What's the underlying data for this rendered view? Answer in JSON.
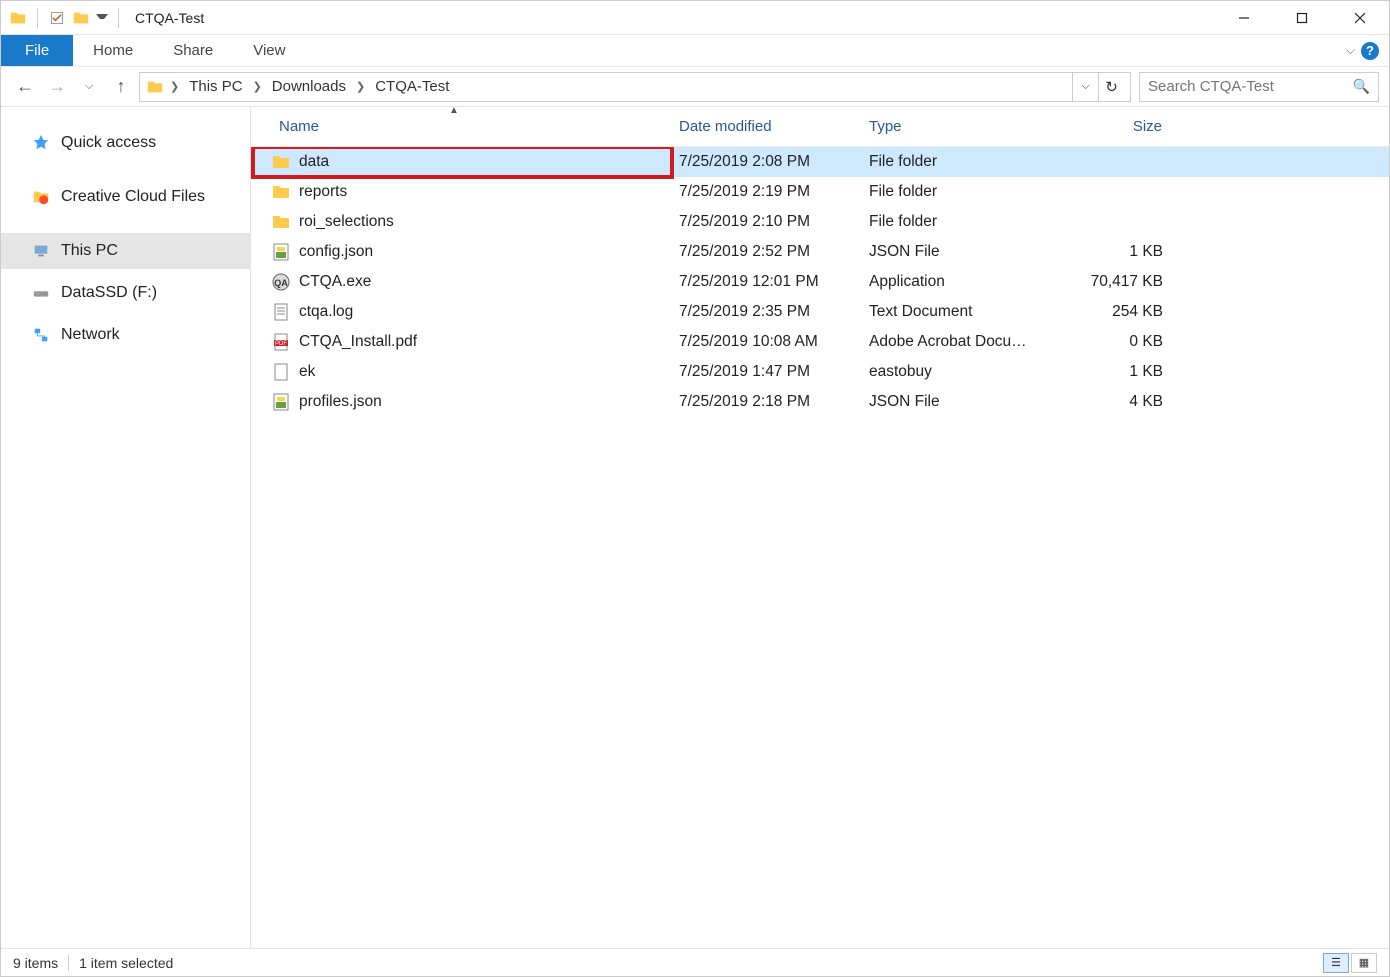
{
  "window": {
    "title": "CTQA-Test"
  },
  "ribbon": {
    "file": "File",
    "home": "Home",
    "share": "Share",
    "view": "View"
  },
  "breadcrumbs": [
    "This PC",
    "Downloads",
    "CTQA-Test"
  ],
  "search": {
    "placeholder": "Search CTQA-Test"
  },
  "sidebar": {
    "items": [
      {
        "label": "Quick access",
        "icon": "star"
      },
      {
        "label": "Creative Cloud Files",
        "icon": "cc"
      },
      {
        "label": "This PC",
        "icon": "pc",
        "selected": true
      },
      {
        "label": "DataSSD (F:)",
        "icon": "drive"
      },
      {
        "label": "Network",
        "icon": "net"
      }
    ]
  },
  "columns": {
    "name": "Name",
    "date": "Date modified",
    "type": "Type",
    "size": "Size"
  },
  "rows": [
    {
      "name": "data",
      "date": "7/25/2019 2:08 PM",
      "type": "File folder",
      "size": "",
      "icon": "folder",
      "selected": true,
      "highlight": true
    },
    {
      "name": "reports",
      "date": "7/25/2019 2:19 PM",
      "type": "File folder",
      "size": "",
      "icon": "folder"
    },
    {
      "name": "roi_selections",
      "date": "7/25/2019 2:10 PM",
      "type": "File folder",
      "size": "",
      "icon": "folder"
    },
    {
      "name": "config.json",
      "date": "7/25/2019 2:52 PM",
      "type": "JSON File",
      "size": "1 KB",
      "icon": "json"
    },
    {
      "name": "CTQA.exe",
      "date": "7/25/2019 12:01 PM",
      "type": "Application",
      "size": "70,417 KB",
      "icon": "exe"
    },
    {
      "name": "ctqa.log",
      "date": "7/25/2019 2:35 PM",
      "type": "Text Document",
      "size": "254 KB",
      "icon": "txt"
    },
    {
      "name": "CTQA_Install.pdf",
      "date": "7/25/2019 10:08 AM",
      "type": "Adobe Acrobat Docu…",
      "size": "0 KB",
      "icon": "pdf"
    },
    {
      "name": "ek",
      "date": "7/25/2019 1:47 PM",
      "type": "eastobuy",
      "size": "1 KB",
      "icon": "blank"
    },
    {
      "name": "profiles.json",
      "date": "7/25/2019 2:18 PM",
      "type": "JSON File",
      "size": "4 KB",
      "icon": "json"
    }
  ],
  "status": {
    "items": "9 items",
    "selected": "1 item selected"
  }
}
